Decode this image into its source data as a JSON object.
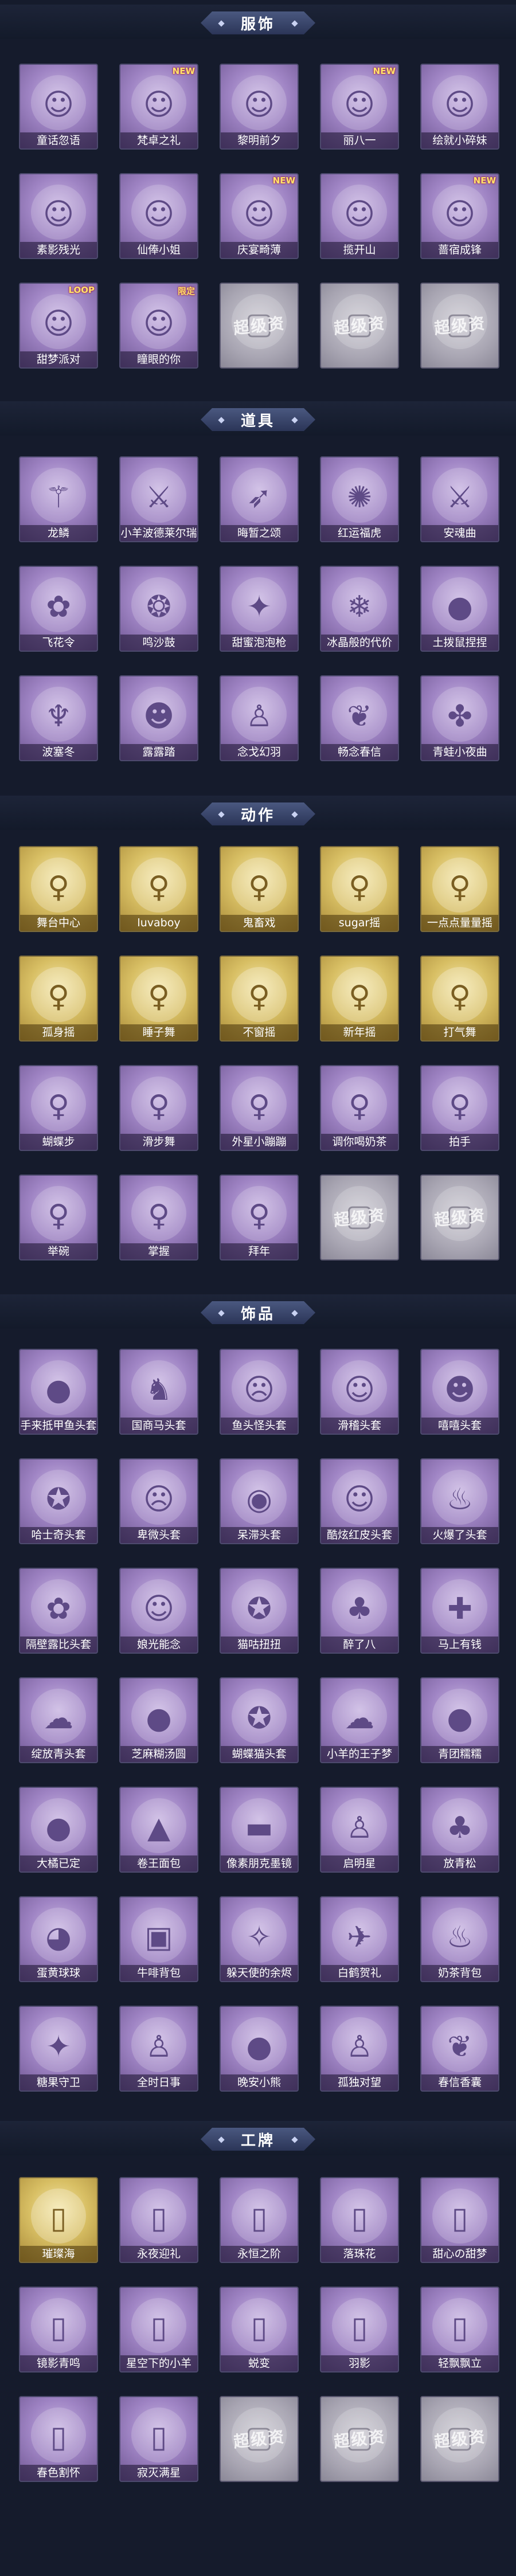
{
  "sections": [
    {
      "title": "服饰",
      "items": [
        {
          "label": "童话忽语",
          "icon": "costume-icon",
          "style": "purple",
          "badge": ""
        },
        {
          "label": "梵卓之礼",
          "icon": "costume-icon",
          "style": "purple",
          "badge": "NEW"
        },
        {
          "label": "黎明前夕",
          "icon": "costume-icon",
          "style": "purple",
          "badge": ""
        },
        {
          "label": "丽八一",
          "icon": "costume-icon",
          "style": "purple",
          "badge": "NEW"
        },
        {
          "label": "绘就小碎妹",
          "icon": "costume-icon",
          "style": "purple",
          "badge": ""
        },
        {
          "label": "素影残光",
          "icon": "costume-icon",
          "style": "purple",
          "badge": ""
        },
        {
          "label": "仙俸小姐",
          "icon": "costume-icon",
          "style": "purple",
          "badge": ""
        },
        {
          "label": "庆宴畸薄",
          "icon": "costume-icon",
          "style": "purple",
          "badge": "NEW"
        },
        {
          "label": "揽开山",
          "icon": "costume-icon",
          "style": "purple",
          "badge": ""
        },
        {
          "label": "蔷宿成锋",
          "icon": "costume-icon",
          "style": "purple",
          "badge": "NEW"
        },
        {
          "label": "甜梦派对",
          "icon": "costume-icon",
          "style": "purple",
          "badge": "LOOP"
        },
        {
          "label": "瞳眼的你",
          "icon": "costume-icon",
          "style": "purple",
          "badge": "限定"
        },
        {
          "label": "",
          "icon": "placeholder-icon",
          "style": "gray",
          "badge": "",
          "watermark": "超级资"
        },
        {
          "label": "",
          "icon": "placeholder-icon",
          "style": "gray",
          "badge": "",
          "watermark": "超级资"
        },
        {
          "label": "",
          "icon": "placeholder-icon",
          "style": "gray",
          "badge": "",
          "watermark": "超级资"
        }
      ]
    },
    {
      "title": "道具",
      "items": [
        {
          "label": "龙鳞",
          "icon": "scepter-icon",
          "style": "purple",
          "badge": ""
        },
        {
          "label": "小羊波德莱尔瑞",
          "icon": "sword-icon",
          "style": "purple",
          "badge": ""
        },
        {
          "label": "晦暂之颂",
          "icon": "bow-icon",
          "style": "purple",
          "badge": ""
        },
        {
          "label": "红运福虎",
          "icon": "tiger-icon",
          "style": "purple",
          "badge": ""
        },
        {
          "label": "安魂曲",
          "icon": "blade-icon",
          "style": "purple",
          "badge": ""
        },
        {
          "label": "飞花令",
          "icon": "lantern-icon",
          "style": "purple",
          "badge": ""
        },
        {
          "label": "鸣沙鼓",
          "icon": "dreamcatcher-icon",
          "style": "purple",
          "badge": ""
        },
        {
          "label": "甜蜜泡泡枪",
          "icon": "bubble-gun-icon",
          "style": "purple",
          "badge": ""
        },
        {
          "label": "冰晶般的代价",
          "icon": "crystal-flower-icon",
          "style": "purple",
          "badge": ""
        },
        {
          "label": "土拨鼠捏捏",
          "icon": "plush-icon",
          "style": "purple",
          "badge": ""
        },
        {
          "label": "波塞冬",
          "icon": "trident-icon",
          "style": "purple",
          "badge": ""
        },
        {
          "label": "露露踏",
          "icon": "doll-icon",
          "style": "purple",
          "badge": ""
        },
        {
          "label": "念戈幻羽",
          "icon": "figure-icon",
          "style": "purple",
          "badge": ""
        },
        {
          "label": "畅念春信",
          "icon": "fan-icon",
          "style": "purple",
          "badge": ""
        },
        {
          "label": "青蛙小夜曲",
          "icon": "frog-icon",
          "style": "purple",
          "badge": ""
        }
      ]
    },
    {
      "title": "动作",
      "items": [
        {
          "label": "舞台中心",
          "icon": "pose-icon",
          "style": "gold",
          "badge": ""
        },
        {
          "label": "luvaboy",
          "icon": "pose-icon",
          "style": "gold",
          "badge": ""
        },
        {
          "label": "鬼畜戏",
          "icon": "pose-icon",
          "style": "gold",
          "badge": ""
        },
        {
          "label": "sugar摇",
          "icon": "pose-icon",
          "style": "gold",
          "badge": ""
        },
        {
          "label": "一点点量量摇",
          "icon": "pose-icon",
          "style": "gold",
          "badge": ""
        },
        {
          "label": "孤身摇",
          "icon": "pose-icon",
          "style": "gold",
          "badge": ""
        },
        {
          "label": "睡子舞",
          "icon": "pose-icon",
          "style": "gold",
          "badge": ""
        },
        {
          "label": "不窗摇",
          "icon": "pose-icon",
          "style": "gold",
          "badge": ""
        },
        {
          "label": "新年摇",
          "icon": "pose-icon",
          "style": "gold",
          "badge": ""
        },
        {
          "label": "打气舞",
          "icon": "pose-icon",
          "style": "gold",
          "badge": ""
        },
        {
          "label": "蝴蝶步",
          "icon": "pose-icon",
          "style": "purple",
          "badge": ""
        },
        {
          "label": "滑步舞",
          "icon": "pose-icon",
          "style": "purple",
          "badge": ""
        },
        {
          "label": "外星小蹦蹦",
          "icon": "pose-icon",
          "style": "purple",
          "badge": ""
        },
        {
          "label": "调你喝奶茶",
          "icon": "pose-icon",
          "style": "purple",
          "badge": ""
        },
        {
          "label": "拍手",
          "icon": "pose-icon",
          "style": "purple",
          "badge": ""
        },
        {
          "label": "举碗",
          "icon": "pose-icon",
          "style": "purple",
          "badge": ""
        },
        {
          "label": "掌握",
          "icon": "pose-icon",
          "style": "purple",
          "badge": ""
        },
        {
          "label": "拜年",
          "icon": "pose-icon",
          "style": "purple",
          "badge": ""
        },
        {
          "label": "",
          "icon": "placeholder-icon",
          "style": "gray",
          "badge": "",
          "watermark": "超级资"
        },
        {
          "label": "",
          "icon": "placeholder-icon",
          "style": "gray",
          "badge": "",
          "watermark": "超级资"
        }
      ]
    },
    {
      "title": "饰品",
      "items": [
        {
          "label": "手来抵甲鱼头套",
          "icon": "fish-head-icon",
          "style": "purple",
          "badge": ""
        },
        {
          "label": "国商马头套",
          "icon": "horse-head-icon",
          "style": "purple",
          "badge": ""
        },
        {
          "label": "鱼头怪头套",
          "icon": "fish-monster-icon",
          "style": "purple",
          "badge": ""
        },
        {
          "label": "滑稽头套",
          "icon": "smile-face-icon",
          "style": "purple",
          "badge": ""
        },
        {
          "label": "嘻嘻头套",
          "icon": "grin-face-icon",
          "style": "purple",
          "badge": ""
        },
        {
          "label": "哈士奇头套",
          "icon": "dog-head-icon",
          "style": "purple",
          "badge": ""
        },
        {
          "label": "卑微头套",
          "icon": "sad-face-icon",
          "style": "purple",
          "badge": ""
        },
        {
          "label": "呆滞头套",
          "icon": "dazed-face-icon",
          "style": "purple",
          "badge": ""
        },
        {
          "label": "酷炫红皮头套",
          "icon": "cool-face-icon",
          "style": "purple",
          "badge": ""
        },
        {
          "label": "火爆了头套",
          "icon": "fire-face-icon",
          "style": "purple",
          "badge": ""
        },
        {
          "label": "隔壁露比头套",
          "icon": "pink-beast-icon",
          "style": "purple",
          "badge": ""
        },
        {
          "label": "娘光能念",
          "icon": "old-face-icon",
          "style": "purple",
          "badge": ""
        },
        {
          "label": "猫咕扭扭",
          "icon": "plush-dog-icon",
          "style": "purple",
          "badge": ""
        },
        {
          "label": "醉了八",
          "icon": "sprout-icon",
          "style": "purple",
          "badge": ""
        },
        {
          "label": "马上有钱",
          "icon": "red-charm-icon",
          "style": "purple",
          "badge": ""
        },
        {
          "label": "绽放青头套",
          "icon": "cloud-icon",
          "style": "purple",
          "badge": ""
        },
        {
          "label": "芝麻糊汤圆",
          "icon": "dumpling-icon",
          "style": "purple",
          "badge": ""
        },
        {
          "label": "蝴蝶猫头套",
          "icon": "cat-head-icon",
          "style": "purple",
          "badge": ""
        },
        {
          "label": "小羊的王子梦",
          "icon": "sheep-icon",
          "style": "purple",
          "badge": ""
        },
        {
          "label": "青团糯糯",
          "icon": "green-ball-icon",
          "style": "purple",
          "badge": ""
        },
        {
          "label": "大橘已定",
          "icon": "orange-icon",
          "style": "purple",
          "badge": ""
        },
        {
          "label": "卷王面包",
          "icon": "bread-icon",
          "style": "purple",
          "badge": ""
        },
        {
          "label": "像素朋克墨镜",
          "icon": "sunglasses-icon",
          "style": "purple",
          "badge": ""
        },
        {
          "label": "启明星",
          "icon": "figure-icon",
          "style": "purple",
          "badge": ""
        },
        {
          "label": "放青松",
          "icon": "bonsai-icon",
          "style": "purple",
          "badge": ""
        },
        {
          "label": "蛋黄球球",
          "icon": "yolk-icon",
          "style": "purple",
          "badge": ""
        },
        {
          "label": "牛啡背包",
          "icon": "backpack-icon",
          "style": "purple",
          "badge": ""
        },
        {
          "label": "躲天使的余烬",
          "icon": "angel-icon",
          "style": "purple",
          "badge": ""
        },
        {
          "label": "白鹤贺礼",
          "icon": "crane-icon",
          "style": "purple",
          "badge": ""
        },
        {
          "label": "奶茶背包",
          "icon": "milk-tea-icon",
          "style": "purple",
          "badge": ""
        },
        {
          "label": "糖果守卫",
          "icon": "candy-icon",
          "style": "purple",
          "badge": ""
        },
        {
          "label": "全时日事",
          "icon": "figure-icon",
          "style": "purple",
          "badge": ""
        },
        {
          "label": "晚安小熊",
          "icon": "bear-icon",
          "style": "purple",
          "badge": ""
        },
        {
          "label": "孤独对望",
          "icon": "figure-icon",
          "style": "purple",
          "badge": ""
        },
        {
          "label": "春信香囊",
          "icon": "sachet-icon",
          "style": "purple",
          "badge": ""
        }
      ]
    },
    {
      "title": "工牌",
      "items": [
        {
          "label": "璀璨海",
          "icon": "card-icon",
          "style": "gold",
          "badge": ""
        },
        {
          "label": "永夜迎礼",
          "icon": "card-icon",
          "style": "purple",
          "badge": ""
        },
        {
          "label": "永恒之阶",
          "icon": "card-icon",
          "style": "purple",
          "badge": ""
        },
        {
          "label": "落珠花",
          "icon": "card-icon",
          "style": "purple",
          "badge": ""
        },
        {
          "label": "甜心の甜梦",
          "icon": "card-icon",
          "style": "purple",
          "badge": ""
        },
        {
          "label": "镜影青鸣",
          "icon": "card-icon",
          "style": "purple",
          "badge": ""
        },
        {
          "label": "星空下的小羊",
          "icon": "card-icon",
          "style": "purple",
          "badge": ""
        },
        {
          "label": "蜕变",
          "icon": "card-icon",
          "style": "purple",
          "badge": ""
        },
        {
          "label": "羽影",
          "icon": "card-icon",
          "style": "purple",
          "badge": ""
        },
        {
          "label": "轻飘飘立",
          "icon": "card-icon",
          "style": "purple",
          "badge": ""
        },
        {
          "label": "春色割怀",
          "icon": "card-icon",
          "style": "purple",
          "badge": ""
        },
        {
          "label": "寂灭满星",
          "icon": "card-icon",
          "style": "purple",
          "badge": ""
        },
        {
          "label": "",
          "icon": "placeholder-icon",
          "style": "gray",
          "badge": "",
          "watermark": "超级资"
        },
        {
          "label": "",
          "icon": "placeholder-icon",
          "style": "gray",
          "badge": "",
          "watermark": "超级资"
        },
        {
          "label": "",
          "icon": "placeholder-icon",
          "style": "gray",
          "badge": "",
          "watermark": "超级资"
        }
      ]
    }
  ],
  "colors": {
    "background": "#151b2c",
    "tile_purple": "#9f84c4",
    "tile_gold": "#d8bf64",
    "tile_gray": "#a9a6b3"
  }
}
